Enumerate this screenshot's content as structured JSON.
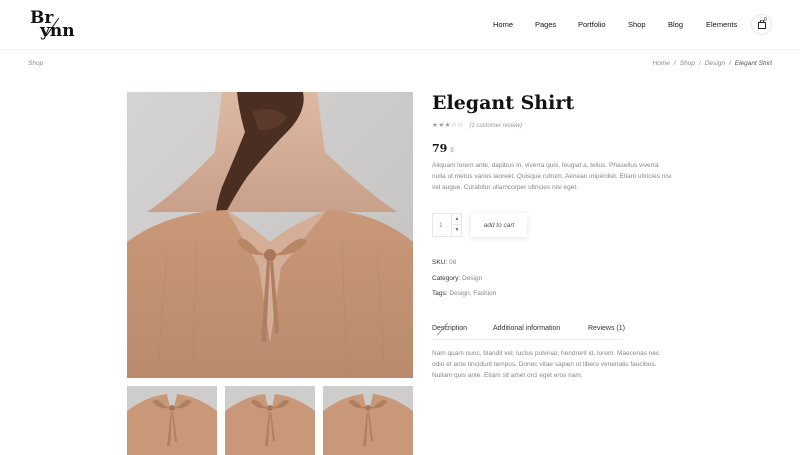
{
  "logo": {
    "line1": "Br",
    "line2": "ynn"
  },
  "nav": {
    "items": [
      "Home",
      "Pages",
      "Portfolio",
      "Shop",
      "Blog",
      "Elements"
    ],
    "cart_count": "0"
  },
  "breadcrumb": {
    "section": "Shop",
    "trail": [
      "Home",
      "Shop",
      "Design"
    ],
    "current": "Elegant Shirt",
    "separator": "/"
  },
  "product": {
    "title": "Elegant Shirt",
    "rating_stars": "★★★☆☆",
    "rating_value": 3,
    "reviews_text": "(1 customer review)",
    "price": "79",
    "currency": "$",
    "description": "Aliquam lorem ante, dapibus in, viverra quis, feugiat a, tellus. Phasellus viverra nulla ut metus varius laoreet. Quisque rutrum. Aenean imperdiet. Etiam ultricies nisi vel augue. Curabitur ullamcorper ultricies nisi eget.",
    "quantity": "1",
    "add_to_cart": "add to cart",
    "sku_label": "SKU:",
    "sku": "08",
    "category_label": "Category:",
    "category": "Design",
    "tags_label": "Tags:",
    "tag1": "Design",
    "tag_sep": ", ",
    "tag2": "Fashion"
  },
  "tabs": {
    "items": [
      "Description",
      "Additional information",
      "Reviews (1)"
    ],
    "active": "Description",
    "content": "Nam quam nunc, blandit vel, luctus pulvinar, hendrerit id, lorem. Maecenas nec odio et ante tincidunt tempus. Donec vitae sapien ut libero venenatis faucibus. Nullam quis ante. Etiam sit amet orci eget eros nam."
  },
  "colors": {
    "fabric": "#c99a7c",
    "backdrop": "#cfcdcb",
    "accent": "#111111",
    "muted": "#888888"
  }
}
